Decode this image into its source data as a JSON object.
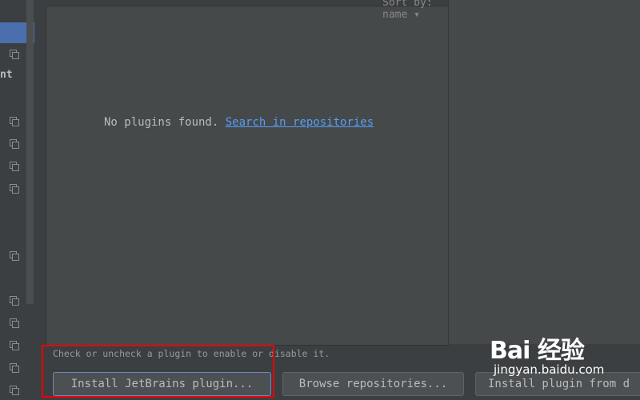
{
  "sidebar": {
    "partial_label": "nt"
  },
  "list": {
    "sort_label": "Sort by: name ▾",
    "empty_message": "No plugins found.",
    "search_link": "Search in repositories"
  },
  "footer": {
    "hint": "Check or uncheck a plugin to enable or disable it.",
    "install_jetbrains": "Install JetBrains plugin...",
    "browse_repos": "Browse repositories...",
    "install_from_disk": "Install plugin from d"
  },
  "watermark": {
    "logo": "Bai  经验",
    "url": "jingyan.baidu.com"
  },
  "colors": {
    "highlight": "#e8000b",
    "link": "#589df6",
    "selection": "#4b6eaf"
  }
}
